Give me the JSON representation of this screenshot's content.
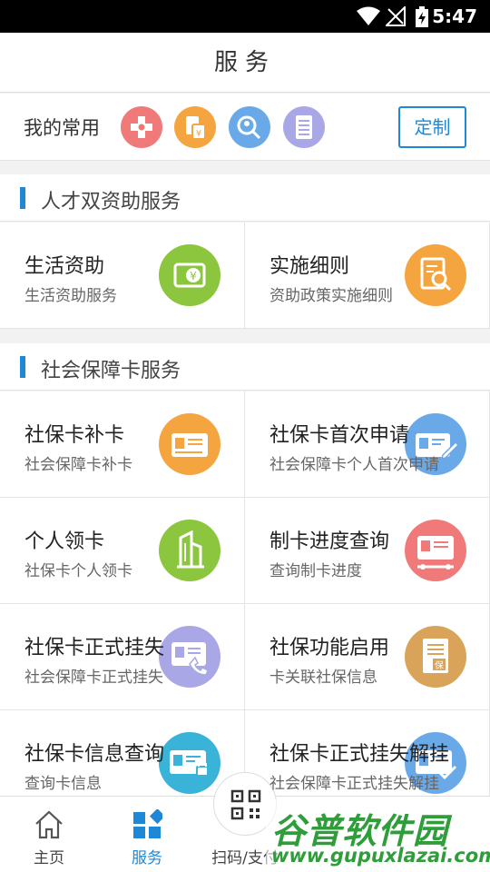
{
  "status_bar": {
    "time": "5:47"
  },
  "header": {
    "title": "服务"
  },
  "favorites": {
    "label": "我的常用",
    "custom_button": "定制",
    "icons": [
      {
        "name": "medical-cross-icon",
        "color": "#f07a7a"
      },
      {
        "name": "bill-yuan-icon",
        "color": "#f4a53f"
      },
      {
        "name": "search-people-icon",
        "color": "#6aa9e8"
      },
      {
        "name": "document-list-icon",
        "color": "#a9a7e6"
      }
    ]
  },
  "sections": [
    {
      "title": "人才双资助服务",
      "items": [
        {
          "title": "生活资助",
          "subtitle": "生活资助服务",
          "icon": "wallet-yuan-icon",
          "color": "#8cc63f"
        },
        {
          "title": "实施细则",
          "subtitle": "资助政策实施细则",
          "icon": "document-search-icon",
          "color": "#f4a53f"
        }
      ]
    },
    {
      "title": "社会保障卡服务",
      "items": [
        {
          "title": "社保卡补卡",
          "subtitle": "社会保障卡补卡",
          "icon": "id-card-icon",
          "color": "#f4a53f"
        },
        {
          "title": "社保卡首次申请",
          "subtitle": "社会保障卡个人首次申请",
          "icon": "card-edit-icon",
          "color": "#6aa9e8"
        },
        {
          "title": "个人领卡",
          "subtitle": "社保卡个人领卡",
          "icon": "building-icon",
          "color": "#8cc63f"
        },
        {
          "title": "制卡进度查询",
          "subtitle": "查询制卡进度",
          "icon": "card-progress-icon",
          "color": "#f07a7a"
        },
        {
          "title": "社保卡正式挂失",
          "subtitle": "社会保障卡正式挂失",
          "icon": "card-phone-icon",
          "color": "#a9a7e6"
        },
        {
          "title": "社保功能启用",
          "subtitle": "卡关联社保信息",
          "icon": "insurance-doc-icon",
          "color": "#d9a45a"
        },
        {
          "title": "社保卡信息查询",
          "subtitle": "查询卡信息",
          "icon": "card-lock-icon",
          "color": "#3ab3d9"
        },
        {
          "title": "社保卡正式挂失解挂",
          "subtitle": "社会保障卡正式挂失解挂",
          "icon": "card-check-icon",
          "color": "#6aa9e8"
        }
      ]
    }
  ],
  "tab_bar": {
    "tabs": [
      {
        "label": "主页",
        "icon": "home-icon",
        "active": false
      },
      {
        "label": "服务",
        "icon": "grid-icon",
        "active": true
      },
      {
        "label": "扫码/支付",
        "icon": "qr-code-icon",
        "active": false
      }
    ],
    "active_color": "#1e88d6"
  },
  "watermark": {
    "title": "谷普软件园",
    "url": "www.gupuxlazai.com"
  }
}
